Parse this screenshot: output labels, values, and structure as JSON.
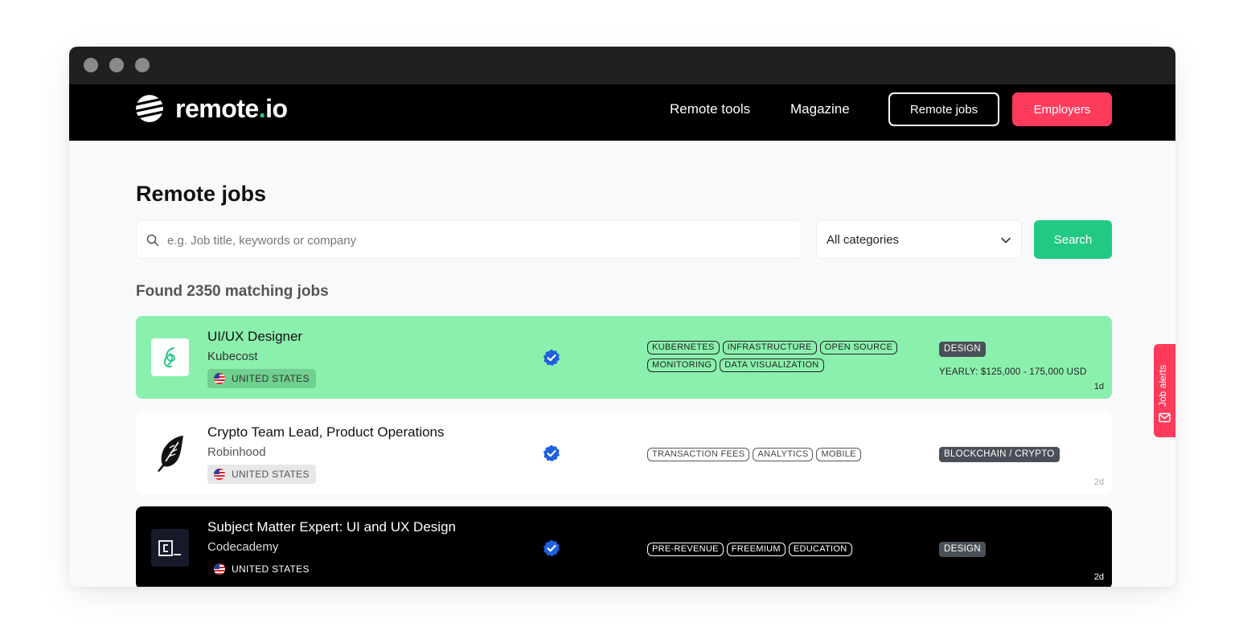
{
  "brand": {
    "name_main": "remote",
    "name_dot": ".",
    "name_tld": "io"
  },
  "nav": {
    "remote_tools": "Remote tools",
    "magazine": "Magazine",
    "remote_jobs": "Remote jobs",
    "employers": "Employers"
  },
  "page": {
    "title": "Remote jobs"
  },
  "search": {
    "placeholder": "e.g. Job title, keywords or company",
    "category": "All categories",
    "button": "Search"
  },
  "results": {
    "found_text": "Found 2350 matching jobs"
  },
  "jobs": [
    {
      "title": "UI/UX Designer",
      "company": "Kubecost",
      "location": "UNITED STATES",
      "tags": [
        "KUBERNETES",
        "INFRASTRUCTURE",
        "OPEN SOURCE",
        "MONITORING",
        "DATA VISUALIZATION"
      ],
      "category": "DESIGN",
      "salary": "YEARLY: $125,000 - 175,000 USD",
      "age": "1d"
    },
    {
      "title": "Crypto Team Lead, Product Operations",
      "company": "Robinhood",
      "location": "UNITED STATES",
      "tags": [
        "TRANSACTION FEES",
        "ANALYTICS",
        "MOBILE"
      ],
      "category": "BLOCKCHAIN / CRYPTO",
      "age": "2d"
    },
    {
      "title": "Subject Matter Expert: UI and UX Design",
      "company": "Codecademy",
      "location": "UNITED STATES",
      "tags": [
        "PRE-REVENUE",
        "FREEMIUM",
        "EDUCATION"
      ],
      "category": "DESIGN",
      "age": "2d"
    }
  ],
  "job_alerts": {
    "label": "Job alerts"
  },
  "colors": {
    "accent_green": "#22c983",
    "accent_red": "#ff3b5c",
    "highlight_green": "#8bf0ad",
    "verified_blue": "#1f5fe0"
  }
}
